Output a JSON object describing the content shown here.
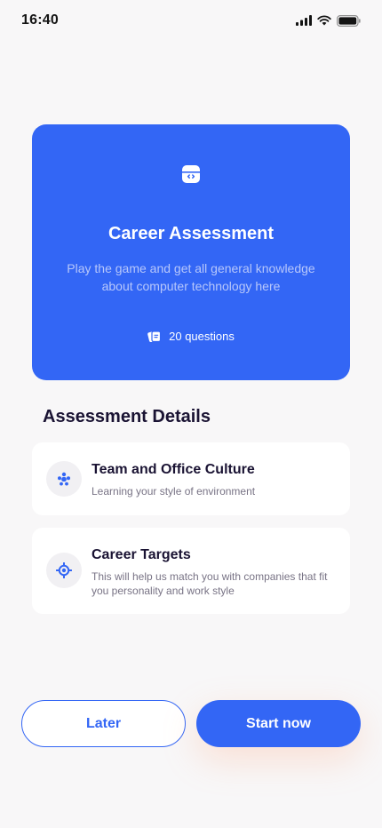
{
  "status_bar": {
    "time": "16:40",
    "icons": [
      "signal-icon",
      "wifi-icon",
      "battery-icon"
    ]
  },
  "hero": {
    "icon": "code-window-icon",
    "title": "Career Assessment",
    "description": "Play the game and get all general knowledge about computer technology here",
    "questions_icon": "cards-icon",
    "questions_label": "20 questions",
    "background_color": "#3366f5"
  },
  "details": {
    "title": "Assessment Details",
    "items": [
      {
        "icon": "team-icon",
        "title": "Team and Office Culture",
        "subtitle": "Learning your style of environment"
      },
      {
        "icon": "target-icon",
        "title": "Career Targets",
        "subtitle": "This will help us match you with companies that fit you personality and work style"
      }
    ]
  },
  "actions": {
    "later_label": "Later",
    "start_label": "Start now",
    "accent_color": "#3366f5"
  }
}
